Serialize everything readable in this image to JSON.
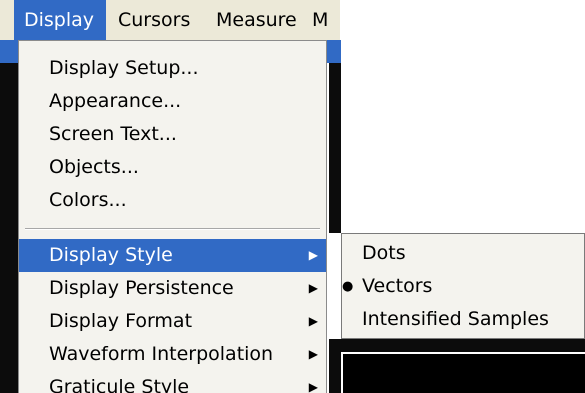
{
  "menubar": {
    "items": [
      {
        "label": "Display",
        "active": true
      },
      {
        "label": "Cursors"
      },
      {
        "label": "Measure"
      },
      {
        "label": "M"
      }
    ]
  },
  "display_menu": {
    "groups": [
      [
        {
          "label": "Display Setup..."
        },
        {
          "label": "Appearance..."
        },
        {
          "label": "Screen Text..."
        },
        {
          "label": "Objects..."
        },
        {
          "label": "Colors..."
        }
      ],
      [
        {
          "label": "Display Style",
          "submenu": true,
          "selected": true
        },
        {
          "label": "Display Persistence",
          "submenu": true
        },
        {
          "label": "Display Format",
          "submenu": true
        },
        {
          "label": "Waveform Interpolation",
          "submenu": true
        },
        {
          "label": "Graticule Style",
          "submenu": true
        }
      ]
    ]
  },
  "display_style_submenu": {
    "items": [
      {
        "label": "Dots"
      },
      {
        "label": "Vectors",
        "checked": true
      },
      {
        "label": "Intensified Samples"
      }
    ]
  },
  "glyphs": {
    "submenu_arrow": "▶",
    "radio_bullet": "●"
  },
  "colors": {
    "highlight": "#316ac5",
    "menu_bg": "#f4f3ee",
    "scope_bg": "#0c0c0c"
  }
}
